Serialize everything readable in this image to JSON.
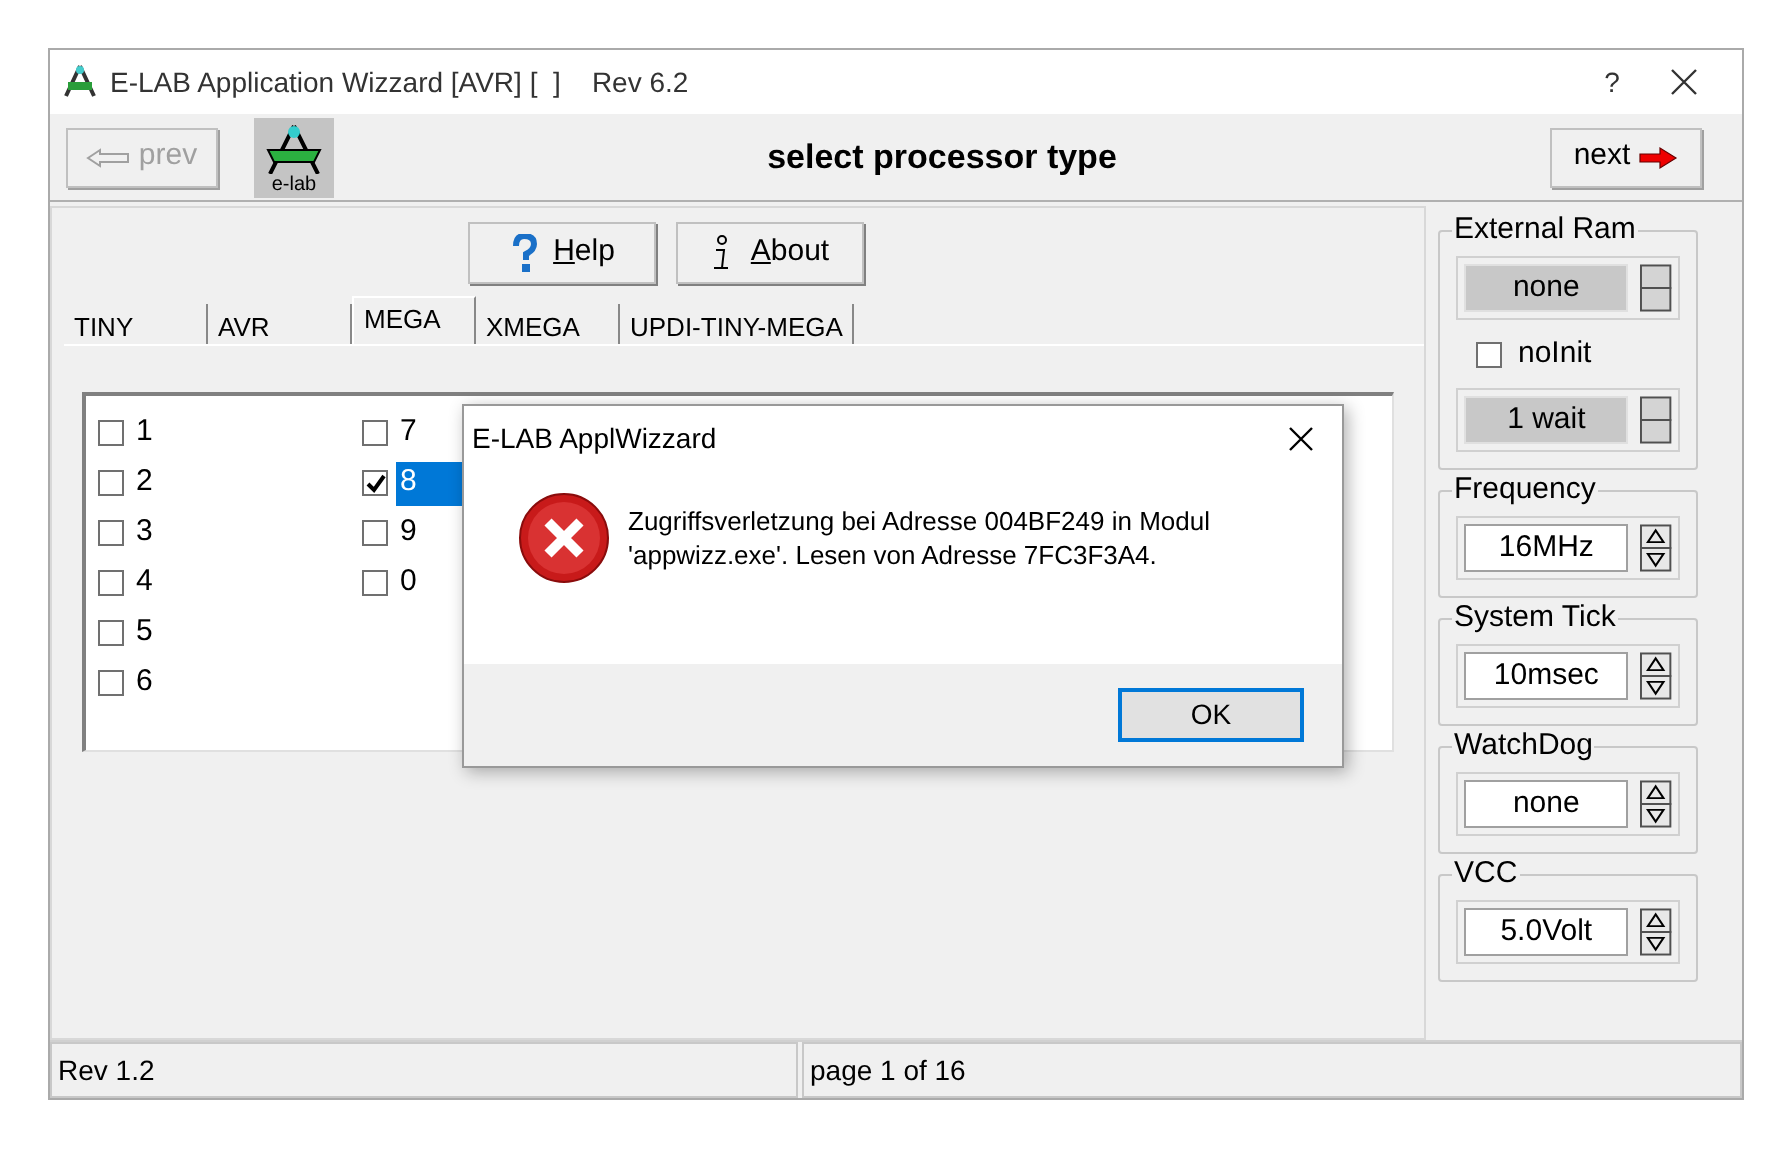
{
  "window": {
    "title": "E-LAB Application Wizzard [AVR] [  ]    Rev 6.2",
    "help_glyph": "?"
  },
  "toolbar": {
    "prev": {
      "label": "prev",
      "disabled": true
    },
    "logo_text": "e-lab",
    "heading": "select processor type",
    "next": {
      "label": "next",
      "disabled": false
    }
  },
  "buttons": [
    {
      "kind": "help",
      "label": "Help"
    },
    {
      "kind": "about",
      "label": "About"
    }
  ],
  "tabs": [
    {
      "label": "TINY",
      "selected": false
    },
    {
      "label": "AVR",
      "selected": false
    },
    {
      "label": "MEGA",
      "selected": true
    },
    {
      "label": "XMEGA",
      "selected": false
    },
    {
      "label": "UPDI-TINY-MEGA",
      "selected": false
    }
  ],
  "processors": [
    [
      {
        "label": "1",
        "checked": false,
        "selected": false
      },
      {
        "label": "2",
        "checked": false,
        "selected": false
      },
      {
        "label": "3",
        "checked": false,
        "selected": false
      },
      {
        "label": "4",
        "checked": false,
        "selected": false
      },
      {
        "label": "5",
        "checked": false,
        "selected": false
      },
      {
        "label": "6",
        "checked": false,
        "selected": false
      }
    ],
    [
      {
        "label": "7",
        "checked": false,
        "selected": false
      },
      {
        "label": "8",
        "checked": true,
        "selected": true
      },
      {
        "label": "9",
        "checked": false,
        "selected": false
      },
      {
        "label": "0",
        "checked": false,
        "selected": false
      }
    ]
  ],
  "settings": [
    {
      "title": "External Ram",
      "items": [
        {
          "kind": "spinner",
          "value": "none",
          "disabled": true
        },
        {
          "kind": "checkbox",
          "label": "noInit",
          "checked": false
        },
        {
          "kind": "spinner",
          "value": "1 wait",
          "disabled": true
        }
      ]
    },
    {
      "title": "Frequency",
      "items": [
        {
          "kind": "spinner",
          "value": "16MHz",
          "disabled": false
        }
      ]
    },
    {
      "title": "System Tick",
      "items": [
        {
          "kind": "spinner",
          "value": "10msec",
          "disabled": false
        }
      ]
    },
    {
      "title": "WatchDog",
      "items": [
        {
          "kind": "spinner",
          "value": "none",
          "disabled": false
        }
      ]
    },
    {
      "title": "VCC",
      "items": [
        {
          "kind": "spinner",
          "value": "5.0Volt",
          "disabled": false
        }
      ]
    }
  ],
  "status_bar": [
    "Rev 1.2",
    "page 1 of 16"
  ],
  "dialog": {
    "title": "E-LAB ApplWizzard",
    "kind": "error",
    "message": "Zugriffsverletzung bei Adresse 004BF249 in Modul 'appwizz.exe'. Lesen von Adresse 7FC3F3A4.",
    "button": "OK"
  }
}
